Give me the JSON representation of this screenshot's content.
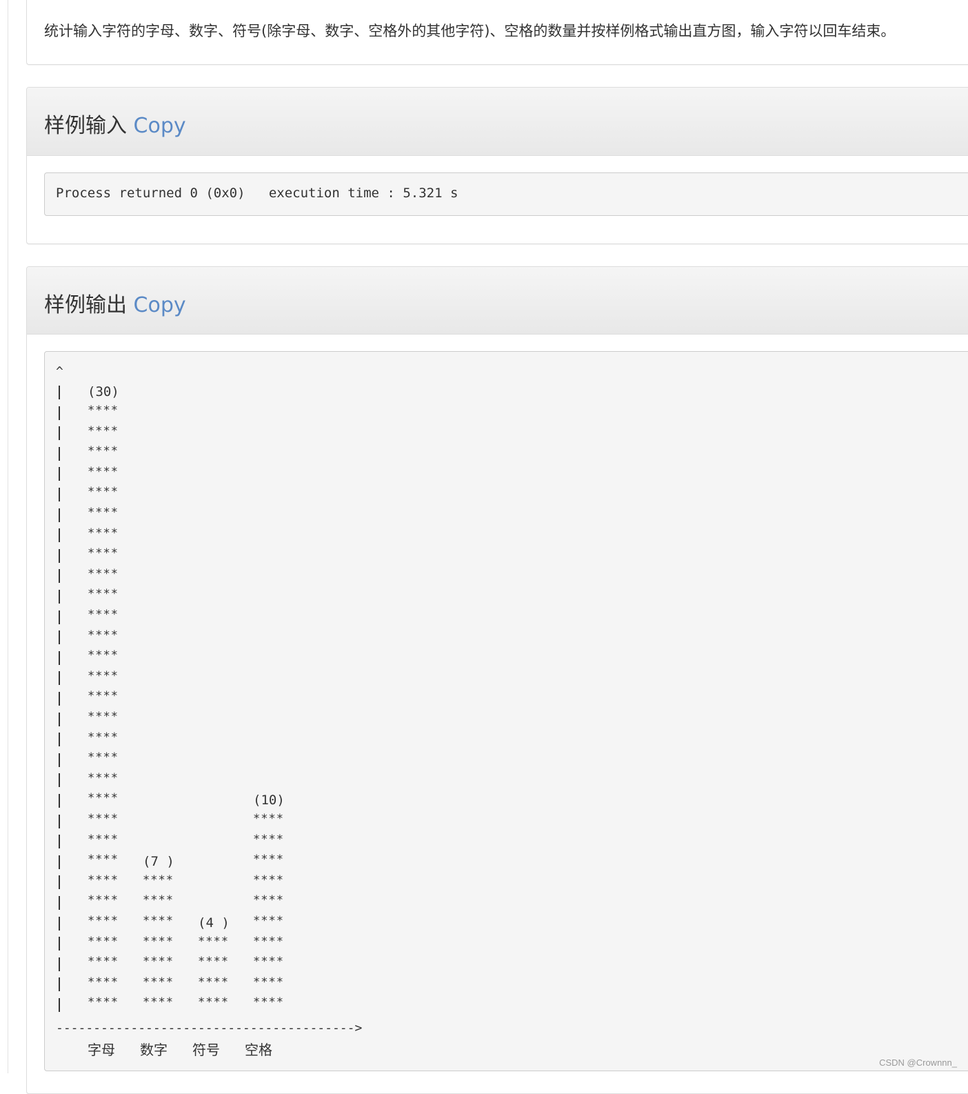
{
  "description": "统计输入字符的字母、数字、符号(除字母、数字、空格外的其他字符)、空格的数量并按样例格式输出直方图，输入字符以回车结束。",
  "sample_input": {
    "title": "样例输入",
    "copy_label": "Copy",
    "code": "Process returned 0 (0x0)   execution time : 5.321 s"
  },
  "sample_output": {
    "title": "样例输出",
    "copy_label": "Copy",
    "axis_top": "^",
    "axis_bottom": "---------------------------------------->",
    "bar_segment": "****"
  },
  "chart_data": {
    "type": "bar",
    "categories": [
      "字母",
      "数字",
      "符号",
      "空格"
    ],
    "values": [
      30,
      7,
      4,
      10
    ],
    "value_labels": [
      "(30)",
      "(7 )",
      "(4 )",
      "(10)"
    ],
    "rows": 30
  },
  "watermark": "CSDN @Crownnn_"
}
